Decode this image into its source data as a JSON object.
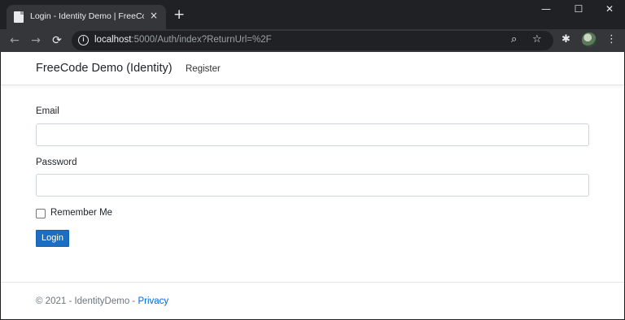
{
  "browser": {
    "tab": {
      "title": "Login - Identity Demo | FreeCode",
      "favicon": "page-icon",
      "close": "×"
    },
    "new_tab": "+",
    "window_controls": {
      "minimize": "—",
      "maximize": "☐",
      "close": "✕"
    },
    "nav": {
      "back": "←",
      "forward": "→",
      "reload": "⟳"
    },
    "address": {
      "host": "localhost",
      "rest": ":5000/Auth/index?ReturnUrl=%2F",
      "info": "i"
    },
    "icons": {
      "zoom": "⌕",
      "star": "☆",
      "extensions": "✱",
      "menu": "⋮"
    }
  },
  "navbar": {
    "brand": "FreeCode Demo (Identity)",
    "links": [
      "Register"
    ]
  },
  "form": {
    "email_label": "Email",
    "email_value": "",
    "password_label": "Password",
    "password_value": "",
    "remember_label": "Remember Me",
    "remember_checked": false,
    "submit_label": "Login"
  },
  "footer": {
    "text": "© 2021 - IdentityDemo - ",
    "link": "Privacy"
  },
  "colors": {
    "primary_button": "#1b6ec2",
    "link": "#0366d6",
    "browser_frame": "#202124",
    "browser_toolbar": "#35363a"
  }
}
